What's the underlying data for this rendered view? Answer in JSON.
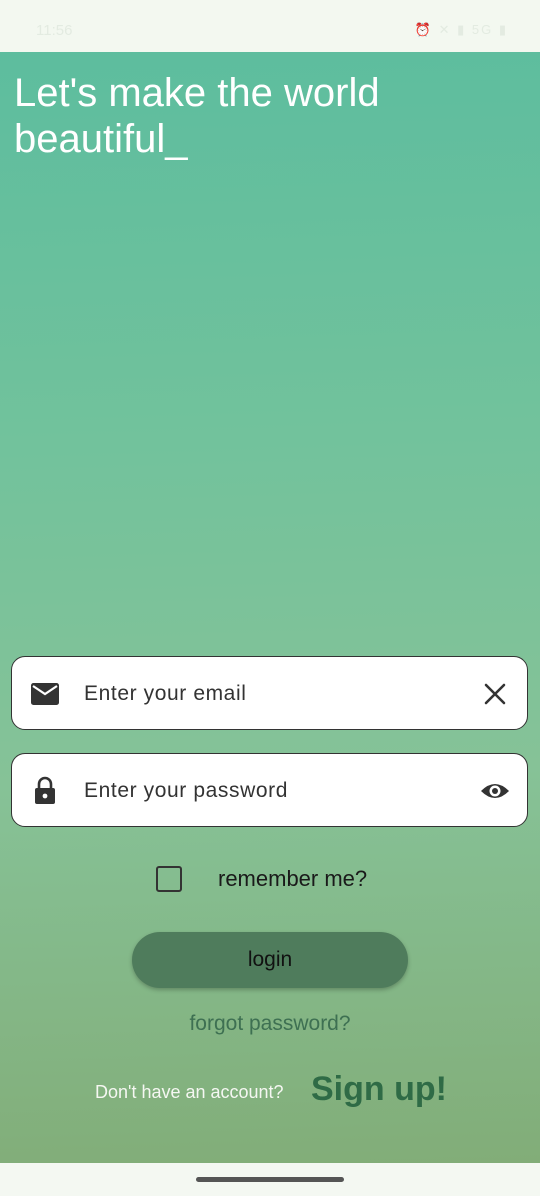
{
  "status_bar": {
    "time": "11:56",
    "right_icons": "⏰ ✕ ▮ 5G ▮"
  },
  "headline": "Let's make the world beautiful_",
  "email_field": {
    "placeholder": "Enter your email",
    "value": ""
  },
  "password_field": {
    "placeholder": "Enter your password",
    "value": ""
  },
  "remember": {
    "label": "remember me?",
    "checked": false
  },
  "login_label": "login",
  "forgot_label": "forgot password?",
  "signup": {
    "prompt": "Don't have an account?",
    "link": "Sign up!"
  },
  "icons": {
    "email": "mail-icon",
    "clear": "close-icon",
    "password": "lock-icon",
    "visibility": "eye-icon"
  },
  "colors": {
    "gradient_top": "#5dbd9e",
    "gradient_bottom": "#82ad78",
    "button": "#4f7c5c",
    "link": "#2f6b46"
  }
}
